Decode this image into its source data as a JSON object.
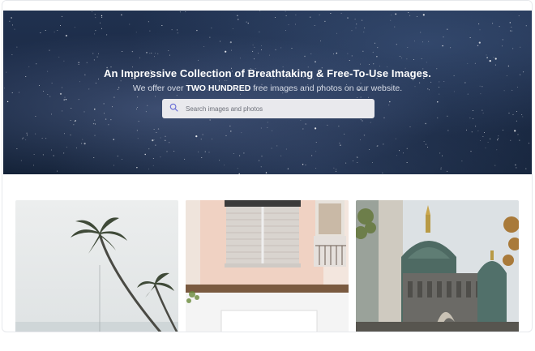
{
  "hero": {
    "title": "An Impressive Collection of Breathtaking & Free-To-Use Images.",
    "subtitle_before": "We offer over ",
    "subtitle_bold": "TWO HUNDRED",
    "subtitle_after": " free images and photos on our website.",
    "search_placeholder": "Search images and photos",
    "search_icon": "search-icon"
  },
  "gallery": {
    "photos": [
      {
        "subject": "palm-trees",
        "icon": "image"
      },
      {
        "subject": "building-facade",
        "icon": "image"
      },
      {
        "subject": "cathedral",
        "icon": "image"
      }
    ]
  },
  "colors": {
    "hero_bg": "#1b2a45",
    "search_bg": "#e9e9ed",
    "accent": "#6b6fd6"
  }
}
